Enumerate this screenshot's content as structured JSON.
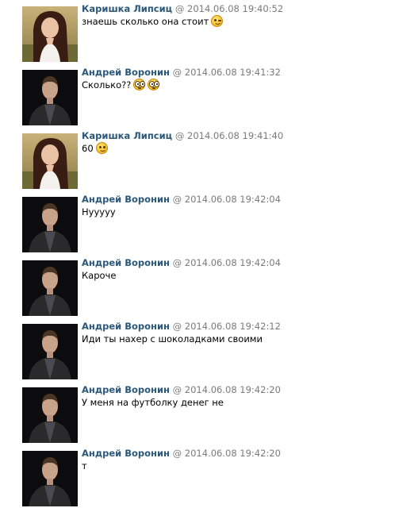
{
  "messages": [
    {
      "author": "Каришка Липсиц",
      "at": "@",
      "time": "2014.06.08 19:40:52",
      "text": "знаешь сколько она стоит",
      "emojis": [
        "wink"
      ],
      "avatar": "girl"
    },
    {
      "author": "Андрей Воронин",
      "at": "@",
      "time": "2014.06.08 19:41:32",
      "text": "Сколько??",
      "emojis": [
        "wide-eyed",
        "wide-eyed"
      ],
      "avatar": "boy"
    },
    {
      "author": "Каришка Липсиц",
      "at": "@",
      "time": "2014.06.08 19:41:40",
      "text": "60",
      "emojis": [
        "smile"
      ],
      "avatar": "girl"
    },
    {
      "author": "Андрей Воронин",
      "at": "@",
      "time": "2014.06.08 19:42:04",
      "text": "Нууууу",
      "emojis": [],
      "avatar": "boy"
    },
    {
      "author": "Андрей Воронин",
      "at": "@",
      "time": "2014.06.08 19:42:04",
      "text": "Кароче",
      "emojis": [],
      "avatar": "boy"
    },
    {
      "author": "Андрей Воронин",
      "at": "@",
      "time": "2014.06.08 19:42:12",
      "text": "Иди ты нахер с шоколадками своими",
      "emojis": [],
      "avatar": "boy"
    },
    {
      "author": "Андрей Воронин",
      "at": "@",
      "time": "2014.06.08 19:42:20",
      "text": "У меня на футболку денег не",
      "emojis": [],
      "avatar": "boy"
    },
    {
      "author": "Андрей Воронин",
      "at": "@",
      "time": "2014.06.08 19:42:20",
      "text": "т",
      "emojis": [],
      "avatar": "boy"
    }
  ],
  "colors": {
    "author": "#2b587a",
    "meta": "#7a7a7a",
    "text": "#000000"
  }
}
